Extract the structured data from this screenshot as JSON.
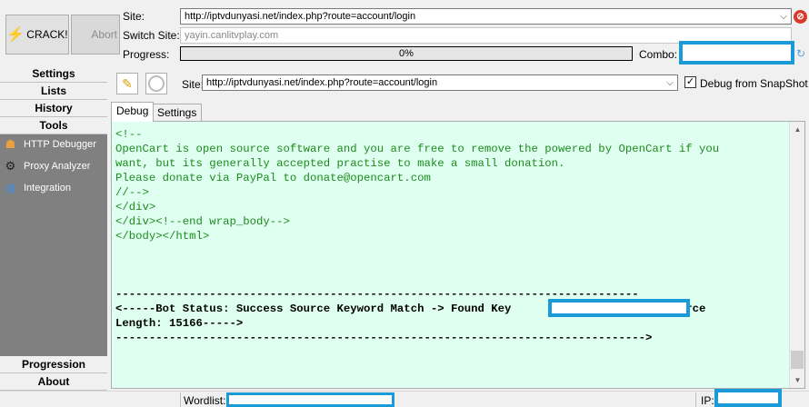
{
  "toolbar": {
    "crack_label": "CRACK!",
    "abort_label": "Abort"
  },
  "form": {
    "site_label": "Site:",
    "site_value": "http://iptvdunyasi.net/index.php?route=account/login",
    "switch_site_label": "Switch Site:",
    "switch_site_value": "yayin.canlitvplay.com",
    "progress_label": "Progress:",
    "progress_text": "0%",
    "progress_fraction": 0,
    "combo_label": "Combo:"
  },
  "sidebar": {
    "headers": [
      "Settings",
      "Lists",
      "History",
      "Tools"
    ],
    "tools": [
      {
        "label": "HTTP Debugger",
        "icon": "debugger-icon"
      },
      {
        "label": "Proxy Analyzer",
        "icon": "proxy-analyzer-icon"
      },
      {
        "label": "Integration",
        "icon": "globe-icon"
      }
    ],
    "bottom_headers": [
      "Progression",
      "About"
    ]
  },
  "debugger": {
    "site_label": "Site:",
    "site_value": "http://iptvdunyasi.net/index.php?route=account/login",
    "debug_snapshot_label": "Debug from SnapShot",
    "debug_snapshot_checked": true,
    "tabs": [
      "Debug",
      "Settings"
    ],
    "source_text": "<!--\nOpenCart is open source software and you are free to remove the powered by OpenCart if you\nwant, but its generally accepted practise to make a small donation.\nPlease donate via PayPal to donate@opencart.com\n//-->\n</div>\n</div><!--end wrap_body-->\n</body></html>",
    "status_text": "------------------------------------------------------------------------------\n<-----Bot Status: Success Source Keyword Match -> Found Key                     - Source\nLength: 15166----->\n------------------------------------------------------------------------------->"
  },
  "statusbar": {
    "wordlist_label": "Wordlist:",
    "ip_label": "IP:"
  },
  "colors": {
    "debug_bg": "#dffff0",
    "source_text": "#1c8c1c",
    "redaction_border": "#1a9ad6",
    "sidebar_bg": "#808080"
  }
}
